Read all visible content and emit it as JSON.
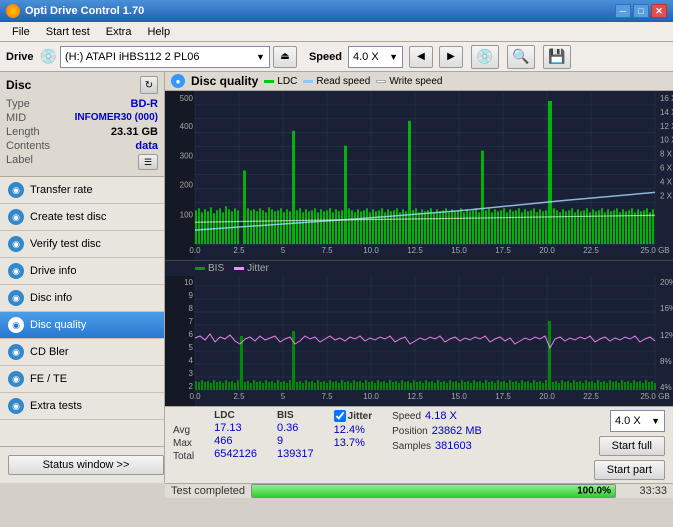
{
  "app": {
    "title": "Opti Drive Control 1.70",
    "icon": "●"
  },
  "title_controls": {
    "minimize": "─",
    "maximize": "□",
    "close": "✕"
  },
  "menu": {
    "items": [
      "File",
      "Start test",
      "Extra",
      "Help"
    ]
  },
  "drive_bar": {
    "label": "Drive",
    "drive_value": "(H:)  ATAPI iHBS112  2 PL06",
    "speed_label": "Speed",
    "speed_value": "4.0 X",
    "eject_icon": "⏏",
    "arrow_icon": "▶"
  },
  "disc": {
    "title": "Disc",
    "type_label": "Type",
    "type_value": "BD-R",
    "mid_label": "MID",
    "mid_value": "INFOMER30 (000)",
    "length_label": "Length",
    "length_value": "23.31 GB",
    "contents_label": "Contents",
    "contents_value": "data",
    "label_label": "Label",
    "refresh_icon": "↻",
    "label_icon": "☰"
  },
  "nav": {
    "items": [
      {
        "id": "transfer-rate",
        "label": "Transfer rate",
        "icon": "◉"
      },
      {
        "id": "create-test-disc",
        "label": "Create test disc",
        "icon": "◉"
      },
      {
        "id": "verify-test-disc",
        "label": "Verify test disc",
        "icon": "◉"
      },
      {
        "id": "drive-info",
        "label": "Drive info",
        "icon": "◉"
      },
      {
        "id": "disc-info",
        "label": "Disc info",
        "icon": "◉"
      },
      {
        "id": "disc-quality",
        "label": "Disc quality",
        "icon": "◉",
        "active": true
      },
      {
        "id": "cd-bler",
        "label": "CD Bler",
        "icon": "◉"
      },
      {
        "id": "fe-te",
        "label": "FE / TE",
        "icon": "◉"
      },
      {
        "id": "extra-tests",
        "label": "Extra tests",
        "icon": "◉"
      }
    ]
  },
  "status_btn": "Status window >>",
  "chart": {
    "title": "Disc quality",
    "legend": {
      "ldc": {
        "label": "LDC",
        "color": "#00cc00"
      },
      "read_speed": {
        "label": "Read speed",
        "color": "#88ccff"
      },
      "write_speed": {
        "label": "Write speed",
        "color": "#ffffff"
      }
    },
    "legend2": {
      "bis": {
        "label": "BIS",
        "color": "#00aa00"
      },
      "jitter": {
        "label": "Jitter",
        "color": "#ff88ff"
      }
    },
    "x_max": "25.0",
    "y_right_max": "16 X",
    "y_right2_max": "20%"
  },
  "stats": {
    "ldc_label": "LDC",
    "bis_label": "BIS",
    "jitter_checked": true,
    "jitter_label": "Jitter",
    "speed_label": "Speed",
    "speed_value": "4.18 X",
    "speed_select": "4.0 X",
    "avg_label": "Avg",
    "avg_ldc": "17.13",
    "avg_bis": "0.36",
    "avg_jitter": "12.4%",
    "max_label": "Max",
    "max_ldc": "466",
    "max_bis": "9",
    "max_jitter": "13.7%",
    "position_label": "Position",
    "position_value": "23862 MB",
    "total_label": "Total",
    "total_ldc": "6542126",
    "total_bis": "139317",
    "samples_label": "Samples",
    "samples_value": "381603",
    "start_full_btn": "Start full",
    "start_part_btn": "Start part"
  },
  "progress": {
    "label": "Test completed",
    "percent": "100.0%",
    "time": "33:33"
  },
  "colors": {
    "accent_blue": "#0000cc",
    "nav_active": "#2878d0",
    "chart_bg": "#1a2035",
    "grid": "#2a3a5a",
    "ldc_green": "#00cc00",
    "bis_green": "#009900",
    "jitter_pink": "#ff88ff",
    "read_speed_blue": "#aaddff",
    "write_speed_white": "#ffffff",
    "progress_green": "#32cd32"
  }
}
